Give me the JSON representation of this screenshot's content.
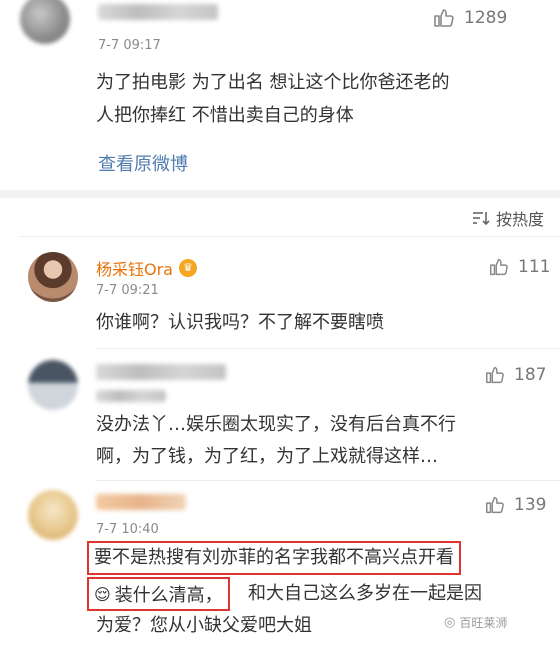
{
  "post": {
    "date": "7-7 09:17",
    "likes": "1289",
    "text_line1": "为了拍电影 为了出名 想让这个比你爸还老的",
    "text_line2": "人把你捧红 不惜出卖自己的身体",
    "view_original": "查看原微博"
  },
  "sort": {
    "label": "按热度"
  },
  "replies": [
    {
      "name": "杨采钰Ora",
      "date": "7-7 09:21",
      "likes": "111",
      "lines": [
        "你谁啊？认识我吗？不了解不要瞎喷"
      ]
    },
    {
      "name": "",
      "date": "",
      "likes": "187",
      "lines": [
        "没办法丫…娱乐圈太现实了，没有后台真不行",
        "啊，为了钱，为了红，为了上戏就得这样…"
      ]
    },
    {
      "name": "",
      "date": "7-7 10:40",
      "likes": "139",
      "lines": [
        "要不是热搜有刘亦菲的名字我都不高兴点开看",
        "装什么清高，",
        "和大自己这么多岁在一起是因",
        "为爱？您从小缺父爱吧大姐"
      ]
    }
  ],
  "watermark": "百旺莱浉",
  "colors": {
    "accent": "#e8740a",
    "link": "#507daf",
    "highlight": "#e0342e"
  }
}
